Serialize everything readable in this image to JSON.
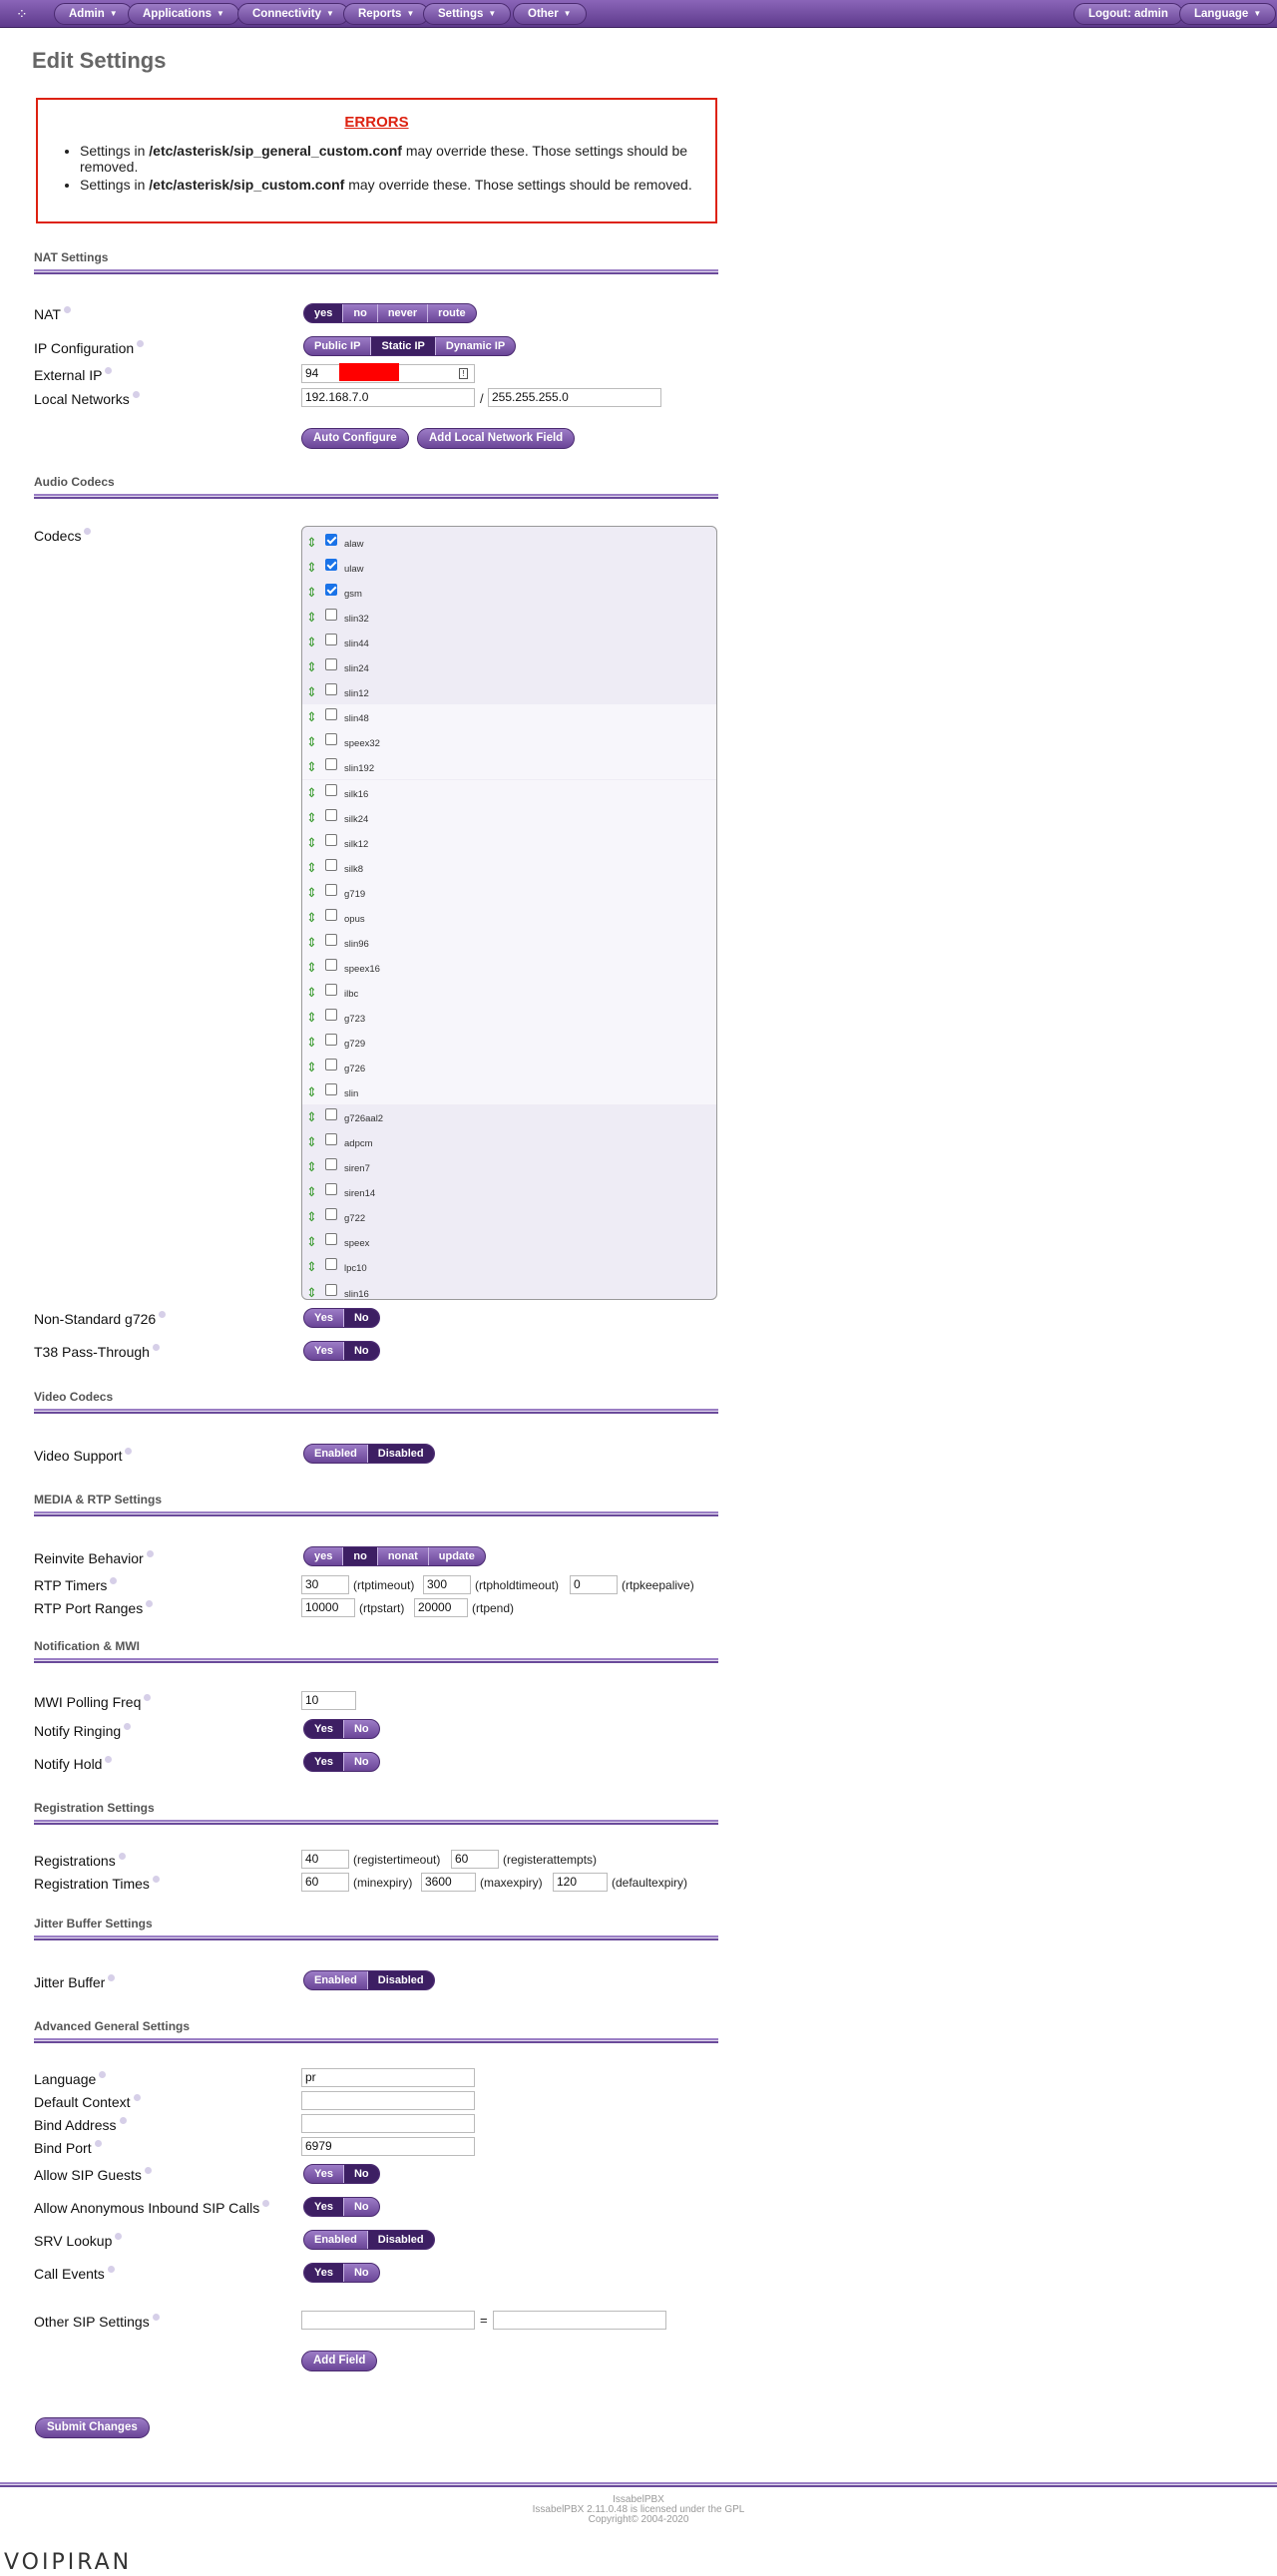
{
  "nav": {
    "menus": [
      "Admin",
      "Applications",
      "Connectivity",
      "Reports",
      "Settings",
      "Other"
    ],
    "logout": "Logout: admin",
    "language": "Language"
  },
  "page": {
    "title": "Edit Settings"
  },
  "errors": {
    "title": "ERRORS",
    "items": [
      {
        "pre": "Settings in ",
        "path": "/etc/asterisk/sip_general_custom.conf",
        "post": " may override these. Those settings should be removed."
      },
      {
        "pre": "Settings in ",
        "path": "/etc/asterisk/sip_custom.conf",
        "post": " may override these. Those settings should be removed."
      }
    ]
  },
  "nat_section": {
    "heading": "NAT Settings",
    "nat_label": "NAT",
    "nat_options": [
      "yes",
      "no",
      "never",
      "route"
    ],
    "nat_selected": "yes",
    "ipconf_label": "IP Configuration",
    "ipconf_options": [
      "Public IP",
      "Static IP",
      "Dynamic IP"
    ],
    "ipconf_selected": "Static IP",
    "extip_label": "External IP",
    "extip_value": "94",
    "localnet_label": "Local Networks",
    "localnet_ip": "192.168.7.0",
    "localnet_sep": "/",
    "localnet_mask": "255.255.255.0",
    "auto_configure": "Auto Configure",
    "add_local_network": "Add Local Network Field"
  },
  "audio_section": {
    "heading": "Audio Codecs",
    "codecs_label": "Codecs",
    "codecs": [
      {
        "name": "alaw",
        "checked": true
      },
      {
        "name": "ulaw",
        "checked": true
      },
      {
        "name": "gsm",
        "checked": true
      },
      {
        "name": "slin32",
        "checked": false
      },
      {
        "name": "slin44",
        "checked": false
      },
      {
        "name": "slin24",
        "checked": false
      },
      {
        "name": "slin12",
        "checked": false
      },
      {
        "name": "slin48",
        "checked": false
      },
      {
        "name": "speex32",
        "checked": false
      },
      {
        "name": "slin192",
        "checked": false
      },
      {
        "name": "silk16",
        "checked": false
      },
      {
        "name": "silk24",
        "checked": false
      },
      {
        "name": "silk12",
        "checked": false
      },
      {
        "name": "silk8",
        "checked": false
      },
      {
        "name": "g719",
        "checked": false
      },
      {
        "name": "opus",
        "checked": false
      },
      {
        "name": "slin96",
        "checked": false
      },
      {
        "name": "speex16",
        "checked": false
      },
      {
        "name": "ilbc",
        "checked": false
      },
      {
        "name": "g723",
        "checked": false
      },
      {
        "name": "g729",
        "checked": false
      },
      {
        "name": "g726",
        "checked": false
      },
      {
        "name": "slin",
        "checked": false
      },
      {
        "name": "g726aal2",
        "checked": false
      },
      {
        "name": "adpcm",
        "checked": false
      },
      {
        "name": "siren7",
        "checked": false
      },
      {
        "name": "siren14",
        "checked": false
      },
      {
        "name": "g722",
        "checked": false
      },
      {
        "name": "speex",
        "checked": false
      },
      {
        "name": "lpc10",
        "checked": false
      },
      {
        "name": "slin16",
        "checked": false
      }
    ],
    "g726_label": "Non-Standard g726",
    "t38_label": "T38 Pass-Through",
    "yes": "Yes",
    "no": "No"
  },
  "video_section": {
    "heading": "Video Codecs",
    "support_label": "Video Support",
    "enabled": "Enabled",
    "disabled": "Disabled"
  },
  "media_section": {
    "heading": "MEDIA & RTP Settings",
    "reinvite_label": "Reinvite Behavior",
    "reinvite_options": [
      "yes",
      "no",
      "nonat",
      "update"
    ],
    "rtp_timers_label": "RTP Timers",
    "rtptimeout": "30",
    "rtptimeout_lbl": "(rtptimeout)",
    "rtpholdtimeout": "300",
    "rtpholdtimeout_lbl": "(rtpholdtimeout)",
    "rtpkeepalive": "0",
    "rtpkeepalive_lbl": "(rtpkeepalive)",
    "rtp_ports_label": "RTP Port Ranges",
    "rtpstart": "10000",
    "rtpstart_lbl": "(rtpstart)",
    "rtpend": "20000",
    "rtpend_lbl": "(rtpend)"
  },
  "notify_section": {
    "heading": "Notification & MWI",
    "mwi_label": "MWI Polling Freq",
    "mwi_value": "10",
    "ringing_label": "Notify Ringing",
    "hold_label": "Notify Hold",
    "yes": "Yes",
    "no": "No"
  },
  "reg_section": {
    "heading": "Registration Settings",
    "registrations_label": "Registrations",
    "registertimeout": "40",
    "registertimeout_lbl": "(registertimeout)",
    "registerattempts": "60",
    "registerattempts_lbl": "(registerattempts)",
    "times_label": "Registration Times",
    "minexpiry": "60",
    "minexpiry_lbl": "(minexpiry)",
    "maxexpiry": "3600",
    "maxexpiry_lbl": "(maxexpiry)",
    "defaultexpiry": "120",
    "defaultexpiry_lbl": "(defaultexpiry)"
  },
  "jitter_section": {
    "heading": "Jitter Buffer Settings",
    "label": "Jitter Buffer",
    "enabled": "Enabled",
    "disabled": "Disabled"
  },
  "adv_section": {
    "heading": "Advanced General Settings",
    "language_label": "Language",
    "language_value": "pr",
    "context_label": "Default Context",
    "context_value": "",
    "bindaddr_label": "Bind Address",
    "bindaddr_value": "",
    "bindport_label": "Bind Port",
    "bindport_value": "6979",
    "guests_label": "Allow SIP Guests",
    "anon_label": "Allow Anonymous Inbound SIP Calls",
    "srv_label": "SRV Lookup",
    "events_label": "Call Events",
    "other_label": "Other SIP Settings",
    "other_eq": "=",
    "add_field": "Add Field",
    "yes": "Yes",
    "no": "No",
    "enabled": "Enabled",
    "disabled": "Disabled"
  },
  "submit": "Submit Changes",
  "footer": {
    "line1": "IssabelPBX",
    "line2": "IssabelPBX 2.11.0.48 is licensed under the GPL",
    "line3": "Copyright© 2004-2020",
    "brand": "VOIPIRAN"
  }
}
